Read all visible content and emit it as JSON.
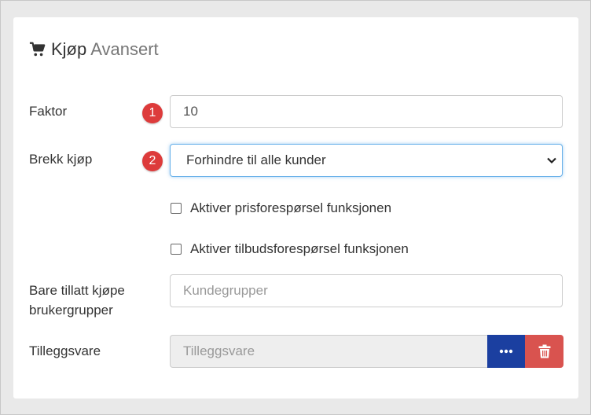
{
  "header": {
    "title": "Kjøp",
    "subtitle": "Avansert",
    "icon": "shopping-cart-icon"
  },
  "form": {
    "faktor": {
      "label": "Faktor",
      "badge": "1",
      "value": "10"
    },
    "brekk": {
      "label": "Brekk kjøp",
      "badge": "2",
      "selected": "Forhindre til alle kunder"
    },
    "checkbox_price": {
      "label": "Aktiver prisforespørsel funksjonen",
      "checked": false
    },
    "checkbox_offer": {
      "label": "Aktiver tilbudsforespørsel funksjonen",
      "checked": false
    },
    "groups": {
      "label_line1": "Bare tillatt kjøpe",
      "label_line2": "brukergrupper",
      "placeholder": "Kundegrupper"
    },
    "addon": {
      "label": "Tilleggsvare",
      "placeholder": "Tilleggsvare"
    }
  },
  "colors": {
    "badge": "#dd3b3b",
    "more_button": "#1b3fa0",
    "delete_button": "#d9534f",
    "focus_border": "#66afe9"
  }
}
